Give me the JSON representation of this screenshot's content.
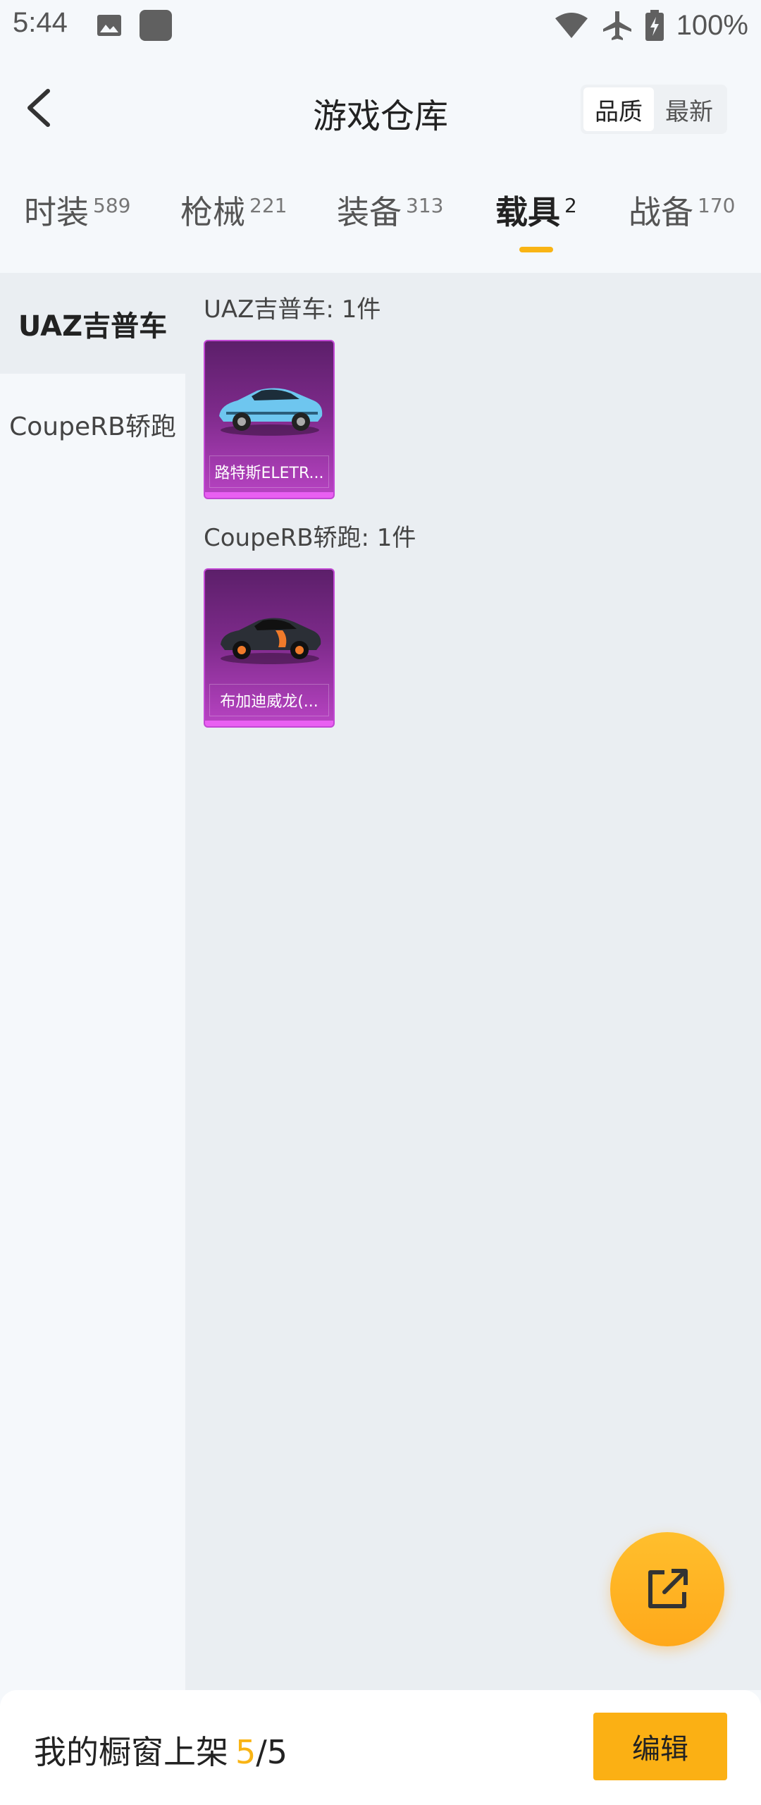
{
  "status_bar": {
    "time": "5:44",
    "battery": "100%",
    "icons": [
      "image-icon",
      "app-icon",
      "wifi-icon",
      "airplane-icon",
      "battery-icon"
    ]
  },
  "header": {
    "title": "游戏仓库",
    "sort_options": [
      "品质",
      "最新"
    ],
    "active_sort": "品质"
  },
  "tabs": [
    {
      "label": "时装",
      "count": "589"
    },
    {
      "label": "枪械",
      "count": "221"
    },
    {
      "label": "装备",
      "count": "313"
    },
    {
      "label": "载具",
      "count": "2"
    },
    {
      "label": "战备",
      "count": "170"
    }
  ],
  "active_tab": "载具",
  "sidebar": {
    "items": [
      "UAZ吉普车",
      "CoupeRB轿跑"
    ],
    "active": "UAZ吉普车"
  },
  "groups": [
    {
      "title": "UAZ吉普车: 1件",
      "items": [
        {
          "name": "路特斯ELETR..."
        }
      ]
    },
    {
      "title": "CoupeRB轿跑: 1件",
      "items": [
        {
          "name": "布加迪威龙(..."
        }
      ]
    }
  ],
  "bottom": {
    "label": "我的橱窗上架",
    "current": "5",
    "separator": "/",
    "total": "5",
    "edit_label": "编辑"
  },
  "colors": {
    "accent": "#f9b414",
    "card_purple": "#7d2a8a",
    "card_bar": "#e95ff2"
  }
}
